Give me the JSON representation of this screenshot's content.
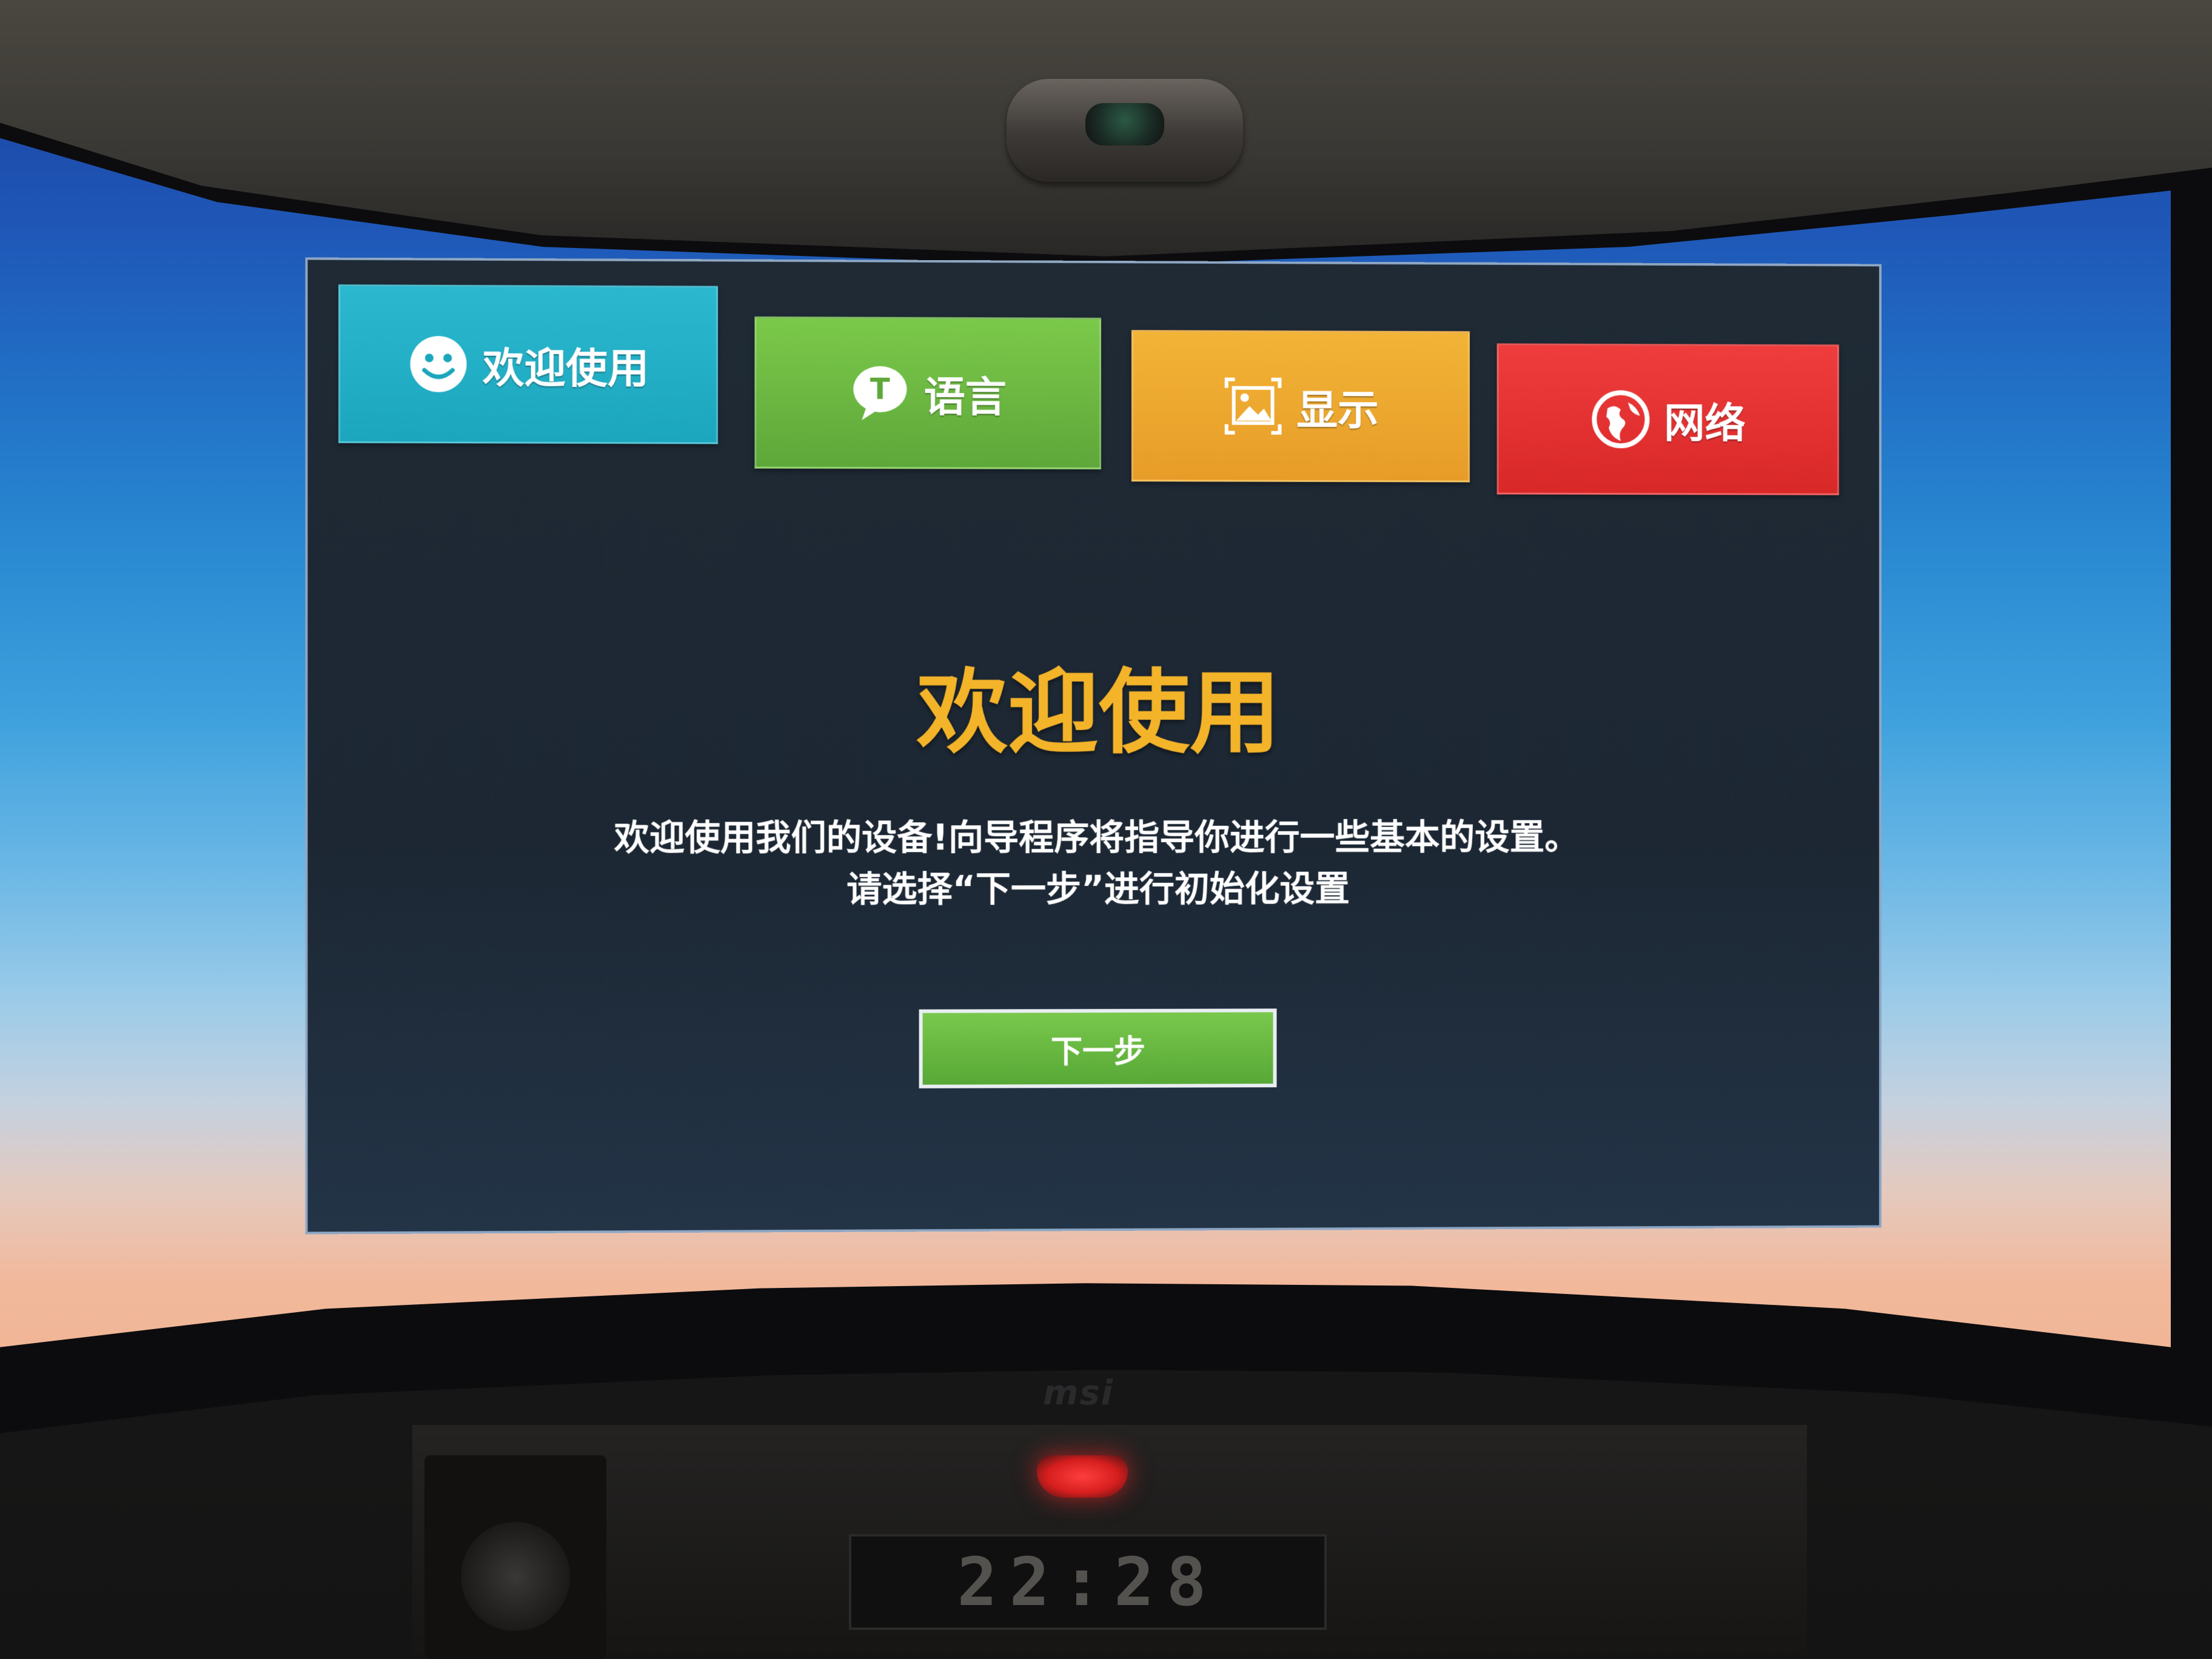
{
  "tabs": [
    {
      "label": "欢迎使用",
      "icon": "smiley-icon",
      "color": "#1fb0c6"
    },
    {
      "label": "语言",
      "icon": "speech-bubble-t-icon",
      "color": "#6bb842"
    },
    {
      "label": "显示",
      "icon": "picture-icon",
      "color": "#eda82f"
    },
    {
      "label": "网络",
      "icon": "globe-icon",
      "color": "#e23030"
    }
  ],
  "main": {
    "title": "欢迎使用",
    "description_line1": "欢迎使用我们的设备!向导程序将指导你进行一些基本的设置。",
    "description_line2": "请选择“下一步”进行初始化设置",
    "next_button": "下一步"
  },
  "monitor": {
    "brand": "msi",
    "clock_display": "22:28"
  },
  "colors": {
    "title": "#f4b42a",
    "button": "#64b33e",
    "panel": "#1e2935"
  }
}
